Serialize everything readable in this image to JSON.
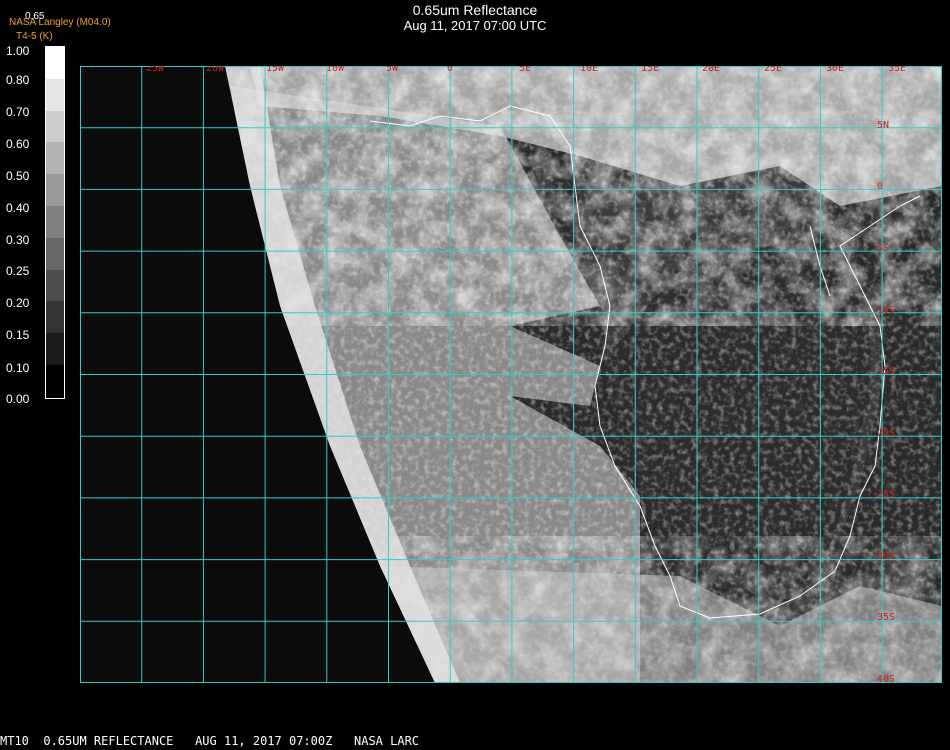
{
  "header": {
    "title": "0.65um Reflectance",
    "subtitle": "Aug 11, 2017 07:00 UTC",
    "credit": "NASA Langley (M04.0)",
    "credit2": "T4-5 (K)",
    "scale_top": "0.65"
  },
  "colorbar": {
    "labels": [
      "1.00",
      "0.80",
      "0.70",
      "0.60",
      "0.50",
      "0.40",
      "0.30",
      "0.25",
      "0.20",
      "0.15",
      "0.10",
      "0.00"
    ]
  },
  "map": {
    "lon_labels": [
      "25W",
      "20W",
      "15W",
      "10W",
      "5W",
      "0",
      "5E",
      "10E",
      "15E",
      "20E",
      "25E",
      "30E",
      "35E"
    ],
    "lat_labels": [
      "5N",
      "0",
      "5S",
      "10S",
      "15S",
      "20S",
      "25S",
      "30S",
      "35S",
      "40S"
    ],
    "grid_color": "#33cccc",
    "label_color": "#cc2222"
  },
  "footer": {
    "text": "MT10  0.65UM REFLECTANCE   AUG 11, 2017 07:00Z   NASA LARC"
  }
}
